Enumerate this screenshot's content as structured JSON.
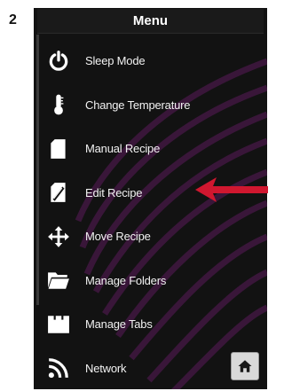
{
  "step": {
    "number": "2"
  },
  "menu": {
    "title": "Menu",
    "items": [
      {
        "label": "Sleep Mode",
        "icon": "power-icon"
      },
      {
        "label": "Change Temperature",
        "icon": "thermometer-icon"
      },
      {
        "label": "Manual Recipe",
        "icon": "document-icon"
      },
      {
        "label": "Edit Recipe",
        "icon": "edit-document-icon"
      },
      {
        "label": "Move Recipe",
        "icon": "move-arrows-icon"
      },
      {
        "label": "Manage Folders",
        "icon": "folder-icon"
      },
      {
        "label": "Manage Tabs",
        "icon": "tabs-icon"
      },
      {
        "label": "Network",
        "icon": "wifi-icon"
      }
    ]
  },
  "home_button": {
    "icon": "home-icon"
  },
  "annotation": {
    "icon": "arrow-left-icon",
    "color": "#d0172f",
    "points_to": "Edit Recipe"
  },
  "colors": {
    "screen_background": "#121212",
    "text": "#f2f2f2",
    "swirl": "#5a1a5a",
    "arrow": "#d0172f"
  }
}
